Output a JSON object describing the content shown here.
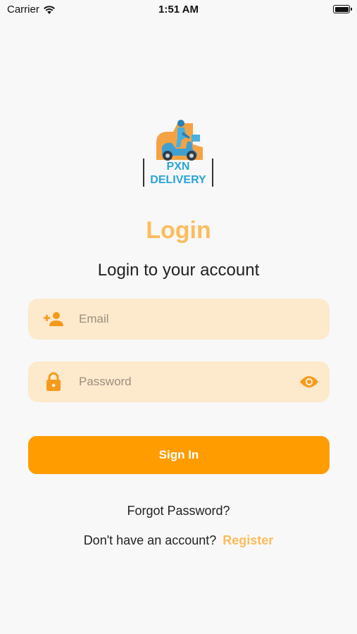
{
  "status_bar": {
    "carrier": "Carrier",
    "time": "1:51 AM"
  },
  "logo": {
    "line1": "PXN",
    "line2": "DELIVERY"
  },
  "login": {
    "title": "Login",
    "subtitle": "Login to your account"
  },
  "email": {
    "placeholder": "Email",
    "value": ""
  },
  "password": {
    "placeholder": "Password",
    "value": ""
  },
  "signin_label": "Sign In",
  "forgot_label": "Forgot Password?",
  "register": {
    "prompt": "Don't have an account?",
    "link": "Register"
  },
  "icons": {
    "email": "person-add-icon",
    "password": "lock-icon",
    "visibility": "eye-icon"
  },
  "colors": {
    "accent": "#ff9c00",
    "title": "#fdbc5c",
    "field_bg": "#fde9cc",
    "logo_text": "#2aa4d8"
  }
}
